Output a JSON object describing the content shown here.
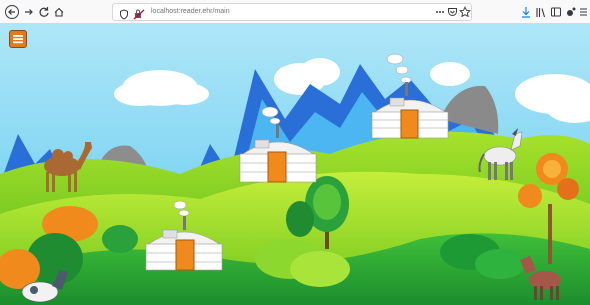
{
  "browser": {
    "back_icon": "arrow-left-icon",
    "forward_icon": "arrow-right-icon",
    "reload_icon": "reload-icon",
    "home_icon": "home-icon",
    "url_host": "reader.ehr",
    "url_text": "localhost:reader.ehr/main",
    "page_actions": [
      "more-icon",
      "pocket-icon",
      "bookmark-star-icon"
    ],
    "tool_icons": [
      "download-icon",
      "library-icon",
      "sidebar-icon",
      "extension-icon",
      "menu-icon"
    ]
  },
  "scene": {
    "menu_button_icon": "hamburger-menu-icon",
    "colors": {
      "sky": "#7fd3f2",
      "mountain_blue": "#2a6fd8",
      "hill_green": "#7cd321",
      "yurt_door": "#f08a1c",
      "menu_button": "#e07a1e"
    },
    "characters": [
      "camel",
      "horse",
      "donkey",
      "calf"
    ],
    "yurts": [
      "yurt-top-right",
      "yurt-middle",
      "yurt-bottom-left"
    ]
  }
}
